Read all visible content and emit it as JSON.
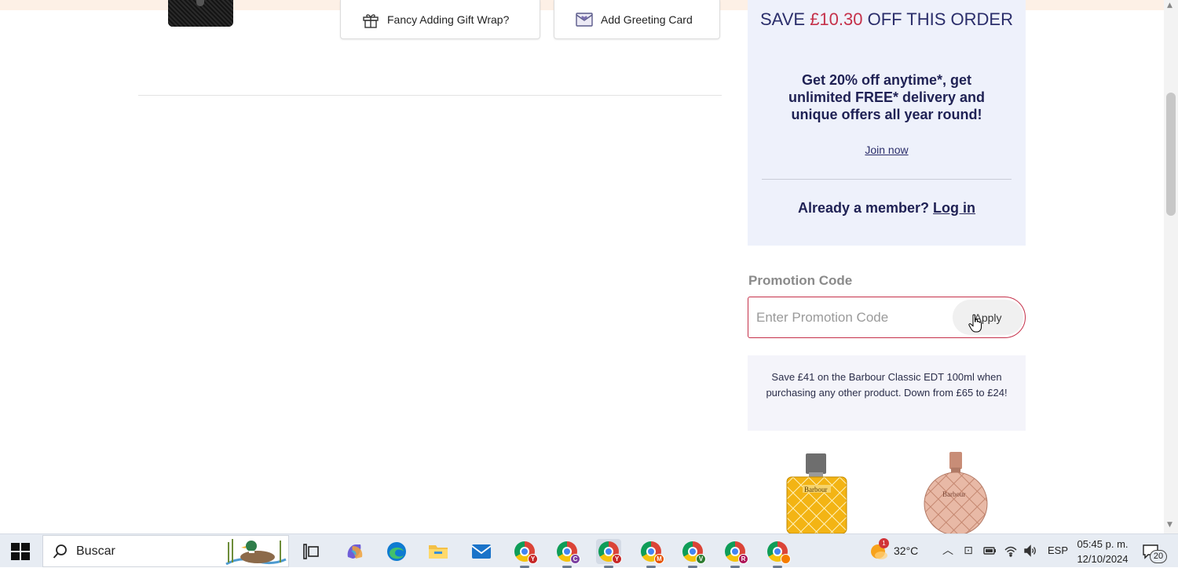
{
  "options": {
    "gift_wrap_label": "Fancy Adding Gift Wrap?",
    "greeting_card_label": "Add Greeting Card"
  },
  "membership": {
    "save_prefix": "SAVE ",
    "save_amount": "£10.30",
    "save_suffix": " OFF THIS ORDER",
    "benefits": "Get 20% off anytime*, get unlimited FREE* delivery and unique offers all year round!",
    "join_label": "Join now",
    "already_member": "Already a member?",
    "login_label": "Log in"
  },
  "promo": {
    "label": "Promotion Code",
    "placeholder": "Enter Promotion Code",
    "apply_label": "Apply"
  },
  "offer_text": "Save £41 on the Barbour Classic EDT 100ml when purchasing any other product. Down from £65 to £24!",
  "products": [
    {
      "brand_label": "Barbour",
      "icon": "gold-perfume-bottle-icon"
    },
    {
      "brand_label": "Barbour",
      "icon": "rose-perfume-bottle-icon"
    }
  ],
  "taskbar": {
    "search_text": "Buscar",
    "apps": [
      {
        "icon": "task-view-icon"
      },
      {
        "icon": "copilot-icon"
      },
      {
        "icon": "edge-icon"
      },
      {
        "icon": "file-explorer-icon"
      },
      {
        "icon": "mail-icon"
      },
      {
        "icon": "chrome-icon",
        "badge": "Y",
        "badge_color": "#c62828"
      },
      {
        "icon": "chrome-icon",
        "badge": "C",
        "badge_color": "#7b3fa0"
      },
      {
        "icon": "chrome-icon",
        "badge": "Y",
        "badge_color": "#c62828"
      },
      {
        "icon": "chrome-icon",
        "badge": "M",
        "badge_color": "#e65100"
      },
      {
        "icon": "chrome-icon",
        "badge": "V",
        "badge_color": "#2e7d32"
      },
      {
        "icon": "chrome-icon",
        "badge": "R",
        "badge_color": "#ad1457"
      },
      {
        "icon": "chrome-icon",
        "badge": "",
        "badge_color": "#f57c00"
      }
    ],
    "weather_badge": "1",
    "temperature": "32°C",
    "language": "ESP",
    "time": "05:45 p. m.",
    "date": "12/10/2024",
    "notification_count": "20"
  },
  "colors": {
    "accent_red": "#c5314a",
    "navy": "#1f2154",
    "panel_bg": "#eef1fb"
  }
}
